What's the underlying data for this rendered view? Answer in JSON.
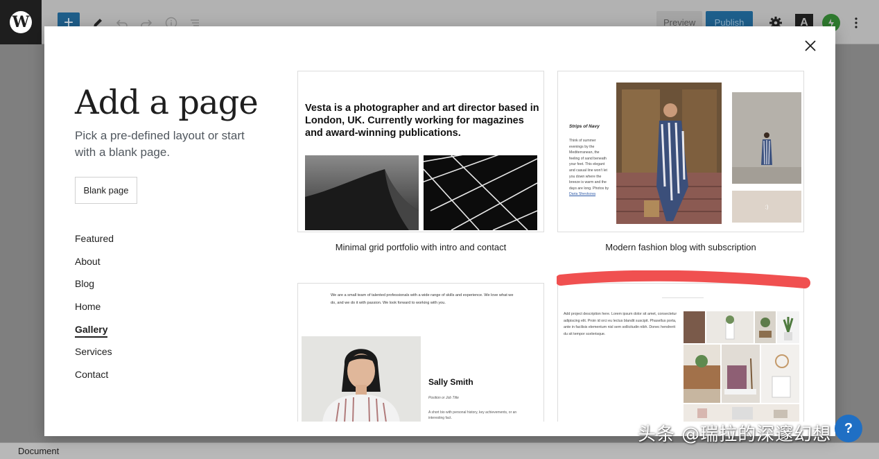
{
  "header": {
    "add_symbol": "+",
    "preview_label": "Preview",
    "publish_label": "Publish",
    "astra_letter": "A",
    "logo_letter": "W"
  },
  "modal": {
    "title": "Add a page",
    "subtitle": "Pick a pre-defined layout or start with a blank page.",
    "blank_button": "Blank page",
    "categories": [
      {
        "label": "Featured",
        "active": false
      },
      {
        "label": "About",
        "active": false
      },
      {
        "label": "Blog",
        "active": false
      },
      {
        "label": "Home",
        "active": false
      },
      {
        "label": "Gallery",
        "active": true
      },
      {
        "label": "Services",
        "active": false
      },
      {
        "label": "Contact",
        "active": false
      }
    ],
    "templates": [
      {
        "caption": "Minimal grid portfolio with intro and contact",
        "headline": "Vesta is a photographer and art director based in London, UK. Currently working for magazines and award-winning publications."
      },
      {
        "caption": "Modern fashion blog with subscription",
        "post_title": "Strips of Navy",
        "post_text": "Think of summer evenings by the Mediterranean, the feeling of sand beneath your feet. This elegant and casual line won't let you down where the breeze is warm and the days are long. Photos by",
        "post_link": "Daria Shevtsova",
        "badge": ":)"
      },
      {
        "intro": "We are a small team of talented professionals with a wide range of skills and experience. We love what we do, and we do it with passion. We look forward to working with you.",
        "name": "Sally Smith",
        "position": "Position or Job Title",
        "bio": "A short bio with personal history, key achievements, or an interesting fact."
      },
      {
        "description": "Add project description here. Lorem ipsum dolor sit amet, consectetur adipiscing elit. Proin id orci eu lectus blandit suscipit. Phasellus porta, ante in facilisis elementum nisl sem sollicitudin nibh. Donec hendrerit du sit tempor scelerisque."
      }
    ]
  },
  "footer": {
    "breadcrumb": "Document"
  },
  "help_symbol": "?",
  "watermark": "头条 @瑞拉的深邃幻想",
  "colors": {
    "accent_red": "#f05050",
    "publish_blue": "#1e5f8c",
    "text_dark": "#1e1e1e"
  }
}
